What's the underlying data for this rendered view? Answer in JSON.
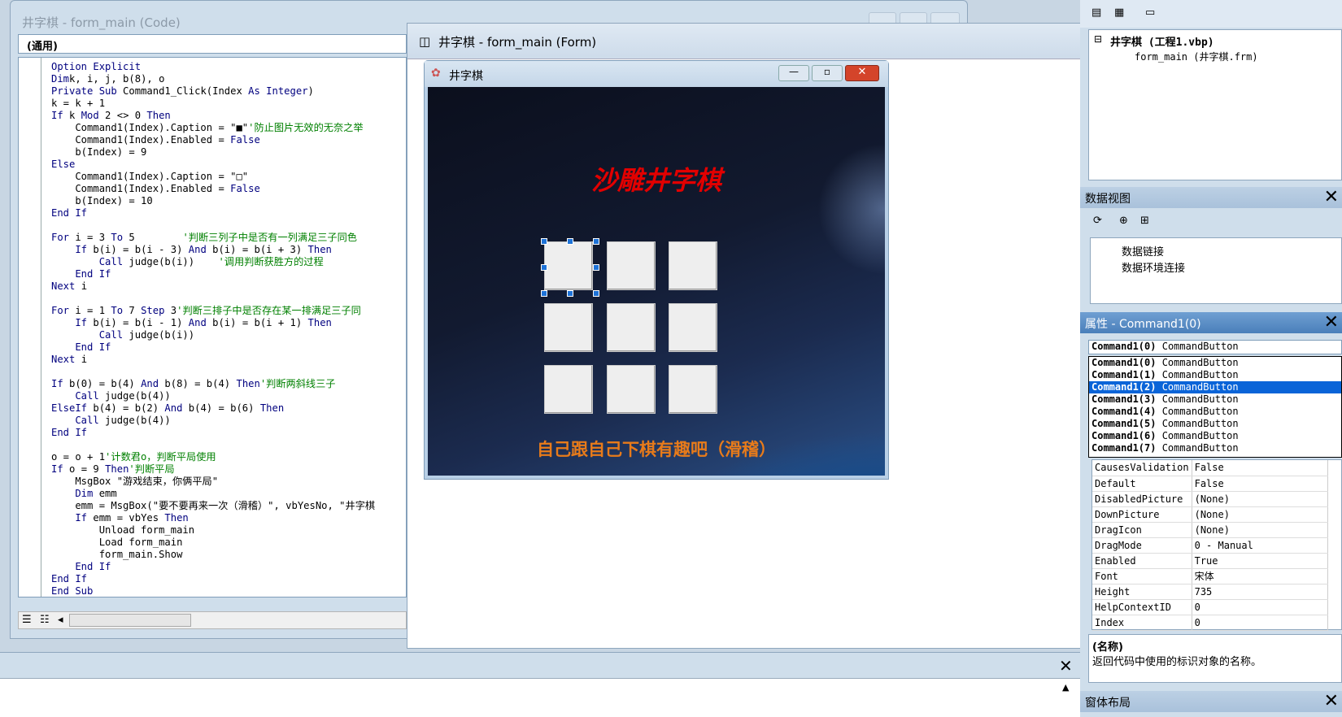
{
  "code_window": {
    "title": "井字棋 - form_main (Code)",
    "combo": "(通用)"
  },
  "code_lines": [
    [
      [
        "kw",
        "Option Explicit"
      ]
    ],
    [
      [
        "kw",
        "Dim"
      ],
      [
        "",
        "k, i, j, b(8), o"
      ]
    ],
    [
      [
        "kw",
        "Private Sub"
      ],
      [
        "",
        " Command1_Click(Index "
      ],
      [
        "kw",
        "As Integer"
      ],
      [
        "",
        ")"
      ]
    ],
    [
      [
        "",
        "k = k + 1"
      ]
    ],
    [
      [
        "kw",
        "If"
      ],
      [
        "",
        " k "
      ],
      [
        "kw",
        "Mod"
      ],
      [
        "",
        " 2 <> 0 "
      ],
      [
        "kw",
        "Then"
      ]
    ],
    [
      [
        "",
        "    Command1(Index).Caption = \"■\""
      ],
      [
        "cm",
        "'防止图片无效的无奈之举"
      ]
    ],
    [
      [
        "",
        "    Command1(Index).Enabled = "
      ],
      [
        "kw",
        "False"
      ]
    ],
    [
      [
        "",
        "    b(Index) = 9"
      ]
    ],
    [
      [
        "kw",
        "Else"
      ]
    ],
    [
      [
        "",
        "    Command1(Index).Caption = \"□\""
      ]
    ],
    [
      [
        "",
        "    Command1(Index).Enabled = "
      ],
      [
        "kw",
        "False"
      ]
    ],
    [
      [
        "",
        "    b(Index) = 10"
      ]
    ],
    [
      [
        "kw",
        "End If"
      ]
    ],
    [
      [
        "",
        ""
      ]
    ],
    [
      [
        "kw",
        "For"
      ],
      [
        "",
        " i = 3 "
      ],
      [
        "kw",
        "To"
      ],
      [
        "",
        " 5        "
      ],
      [
        "cm",
        "'判断三列子中是否有一列满足三子同色"
      ]
    ],
    [
      [
        "kw",
        "    If"
      ],
      [
        "",
        " b(i) = b(i - 3) "
      ],
      [
        "kw",
        "And"
      ],
      [
        "",
        " b(i) = b(i + 3) "
      ],
      [
        "kw",
        "Then"
      ]
    ],
    [
      [
        "kw",
        "        Call"
      ],
      [
        "",
        " judge(b(i))    "
      ],
      [
        "cm",
        "'调用判断获胜方的过程"
      ]
    ],
    [
      [
        "kw",
        "    End If"
      ]
    ],
    [
      [
        "kw",
        "Next"
      ],
      [
        "",
        " i"
      ]
    ],
    [
      [
        "",
        ""
      ]
    ],
    [
      [
        "kw",
        "For"
      ],
      [
        "",
        " i = 1 "
      ],
      [
        "kw",
        "To"
      ],
      [
        "",
        " 7 "
      ],
      [
        "kw",
        "Step"
      ],
      [
        "",
        " 3"
      ],
      [
        "cm",
        "'判断三排子中是否存在某一排满足三子同"
      ]
    ],
    [
      [
        "kw",
        "    If"
      ],
      [
        "",
        " b(i) = b(i - 1) "
      ],
      [
        "kw",
        "And"
      ],
      [
        "",
        " b(i) = b(i + 1) "
      ],
      [
        "kw",
        "Then"
      ]
    ],
    [
      [
        "kw",
        "        Call"
      ],
      [
        "",
        " judge(b(i))"
      ]
    ],
    [
      [
        "kw",
        "    End If"
      ]
    ],
    [
      [
        "kw",
        "Next"
      ],
      [
        "",
        " i"
      ]
    ],
    [
      [
        "",
        ""
      ]
    ],
    [
      [
        "kw",
        "If"
      ],
      [
        "",
        " b(0) = b(4) "
      ],
      [
        "kw",
        "And"
      ],
      [
        "",
        " b(8) = b(4) "
      ],
      [
        "kw",
        "Then"
      ],
      [
        "cm",
        "'判断两斜线三子"
      ]
    ],
    [
      [
        "kw",
        "    Call"
      ],
      [
        "",
        " judge(b(4))"
      ]
    ],
    [
      [
        "kw",
        "ElseIf"
      ],
      [
        "",
        " b(4) = b(2) "
      ],
      [
        "kw",
        "And"
      ],
      [
        "",
        " b(4) = b(6) "
      ],
      [
        "kw",
        "Then"
      ]
    ],
    [
      [
        "kw",
        "    Call"
      ],
      [
        "",
        " judge(b(4))"
      ]
    ],
    [
      [
        "kw",
        "End If"
      ]
    ],
    [
      [
        "",
        ""
      ]
    ],
    [
      [
        "",
        "o = o + 1"
      ],
      [
        "cm",
        "'计数君o，判断平局使用"
      ]
    ],
    [
      [
        "kw",
        "If"
      ],
      [
        "",
        " o = 9 "
      ],
      [
        "kw",
        "Then"
      ],
      [
        "cm",
        "'判断平局"
      ]
    ],
    [
      [
        "",
        "    MsgBox \"游戏结束，你俩平局\""
      ]
    ],
    [
      [
        "kw",
        "    Dim"
      ],
      [
        "",
        " emm"
      ]
    ],
    [
      [
        "",
        "    emm = MsgBox(\"要不要再来一次（滑稽）\", vbYesNo, \"井字棋"
      ]
    ],
    [
      [
        "kw",
        "    If"
      ],
      [
        "",
        " emm = vbYes "
      ],
      [
        "kw",
        "Then"
      ]
    ],
    [
      [
        "",
        "        Unload form_main"
      ]
    ],
    [
      [
        "",
        "        Load form_main"
      ]
    ],
    [
      [
        "",
        "        form_main.Show"
      ]
    ],
    [
      [
        "kw",
        "    End If"
      ]
    ],
    [
      [
        "kw",
        "End If"
      ]
    ],
    [
      [
        "kw",
        "End Sub"
      ]
    ]
  ],
  "form_window": {
    "title": "井字棋 - form_main (Form)"
  },
  "game": {
    "caption": "井字棋",
    "title": "沙雕井字棋",
    "subtitle": "自己跟自己下棋有趣吧（滑稽）"
  },
  "project": {
    "root": "井字棋 (工程1.vbp)",
    "child": "form_main (井字棋.frm)"
  },
  "dataview": {
    "title": "数据视图",
    "items": [
      "数据链接",
      "数据环境连接"
    ]
  },
  "properties": {
    "title": "属性 - Command1(0)",
    "object_name": "Command1(0)",
    "object_type": "CommandButton",
    "dropdown": [
      {
        "n": "Command1(0)",
        "t": "CommandButton",
        "sel": false
      },
      {
        "n": "Command1(1)",
        "t": "CommandButton",
        "sel": false
      },
      {
        "n": "Command1(2)",
        "t": "CommandButton",
        "sel": true
      },
      {
        "n": "Command1(3)",
        "t": "CommandButton",
        "sel": false
      },
      {
        "n": "Command1(4)",
        "t": "CommandButton",
        "sel": false
      },
      {
        "n": "Command1(5)",
        "t": "CommandButton",
        "sel": false
      },
      {
        "n": "Command1(6)",
        "t": "CommandButton",
        "sel": false
      },
      {
        "n": "Command1(7)",
        "t": "CommandButton",
        "sel": false
      }
    ],
    "rows": [
      [
        "CausesValidation",
        "False"
      ],
      [
        "Default",
        "False"
      ],
      [
        "DisabledPicture",
        "(None)"
      ],
      [
        "DownPicture",
        "(None)"
      ],
      [
        "DragIcon",
        "(None)"
      ],
      [
        "DragMode",
        "0 - Manual"
      ],
      [
        "Enabled",
        "True"
      ],
      [
        "Font",
        "宋体"
      ],
      [
        "Height",
        "735"
      ],
      [
        "HelpContextID",
        "0"
      ],
      [
        "Index",
        "0"
      ]
    ],
    "desc_title": "(名称)",
    "desc_text": "返回代码中使用的标识对象的名称。",
    "selected_color": "#0a64d8"
  },
  "layout_panel": {
    "title": "窗体布局"
  }
}
